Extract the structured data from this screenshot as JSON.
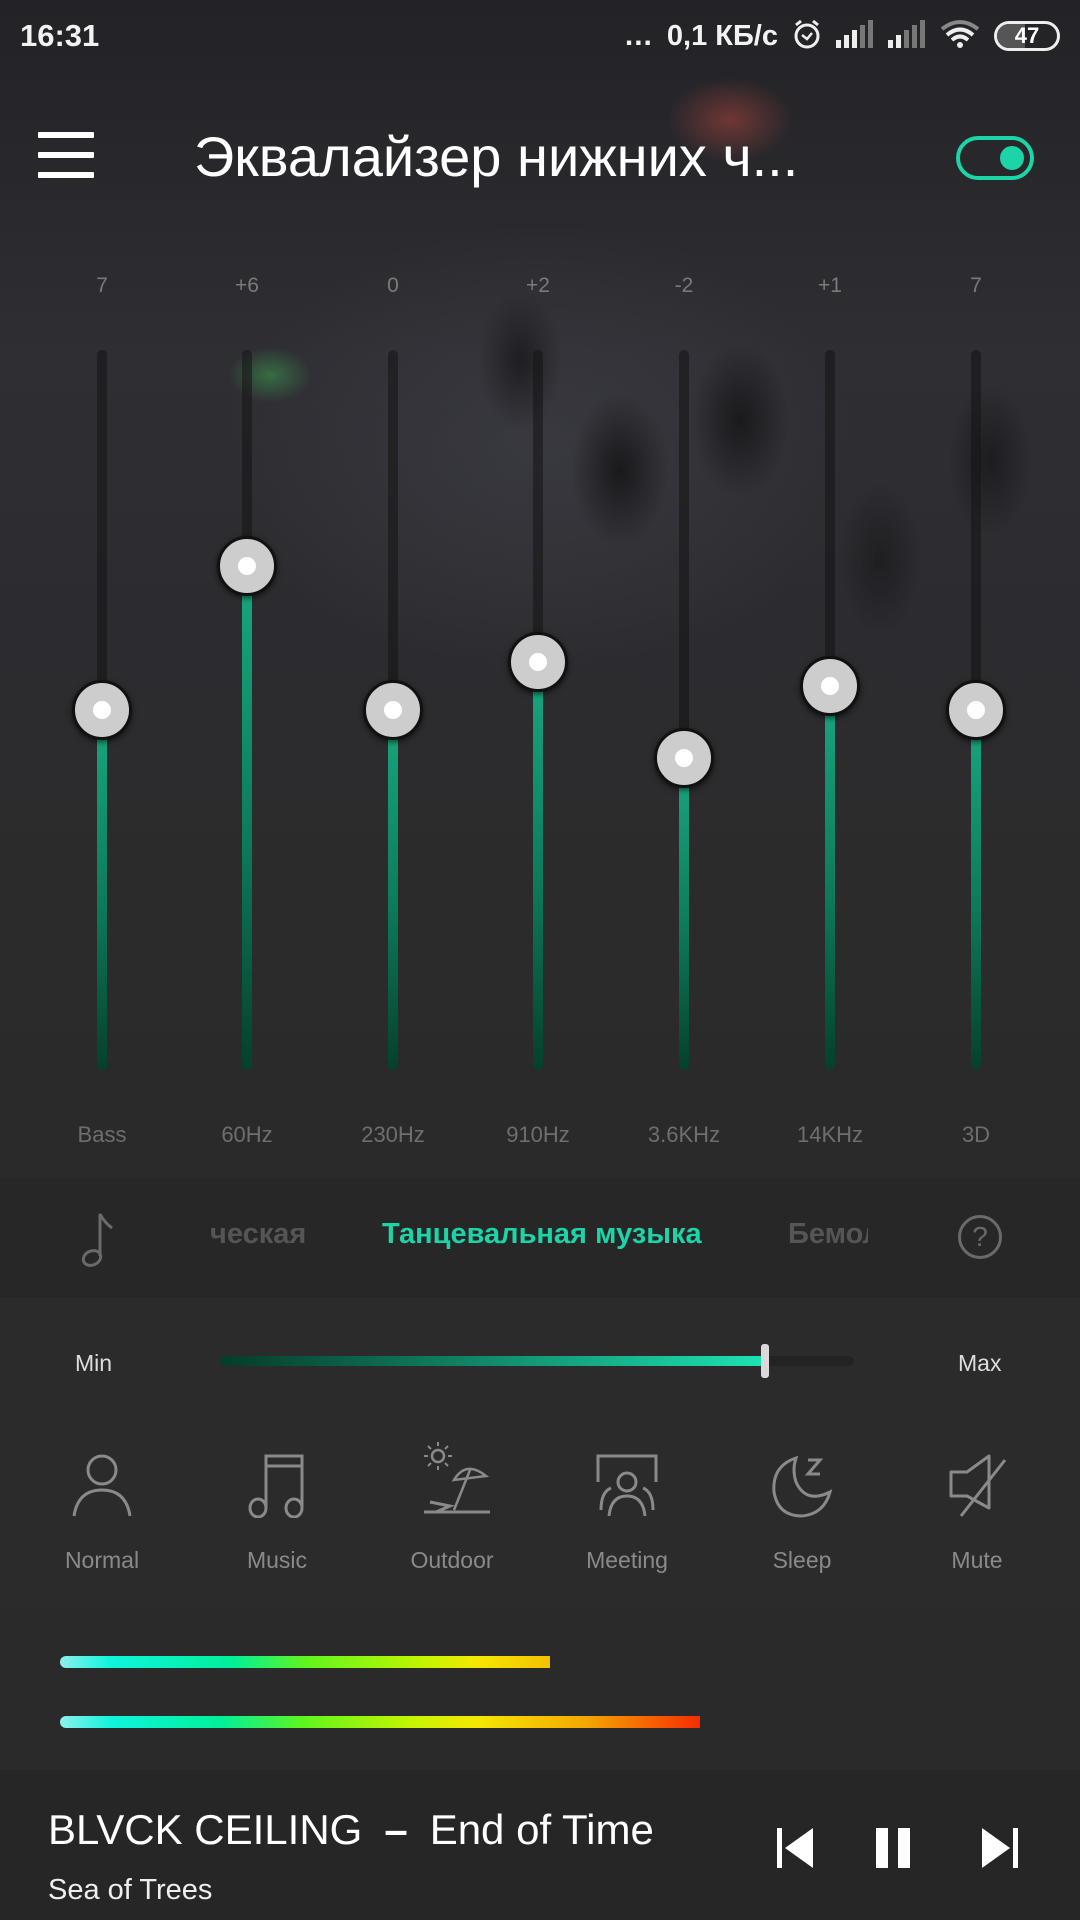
{
  "status_bar": {
    "time": "16:31",
    "dots": "...",
    "net_speed": "0,1 КБ/с",
    "icons": [
      "alarm-icon",
      "signal-icon",
      "signal-icon",
      "wifi-icon",
      "battery-icon"
    ],
    "battery": "47",
    "battery_percent": 47
  },
  "header": {
    "menu_icon": "hamburger-menu-icon",
    "title": "Эквалайзер нижних ч...",
    "toggle_on": true,
    "accent_color": "#1dd3a8"
  },
  "equalizer": {
    "range": [
      -15,
      15
    ],
    "bands": [
      {
        "label": "Bass",
        "value_text": "7",
        "position": 0.5
      },
      {
        "label": "60Hz",
        "value_text": "+6",
        "position": 0.7
      },
      {
        "label": "230Hz",
        "value_text": "0",
        "position": 0.5
      },
      {
        "label": "910Hz",
        "value_text": "+2",
        "position": 0.567
      },
      {
        "label": "3.6KHz",
        "value_text": "-2",
        "position": 0.433
      },
      {
        "label": "14KHz",
        "value_text": "+1",
        "position": 0.533
      },
      {
        "label": "3D",
        "value_text": "7",
        "position": 0.5
      }
    ]
  },
  "presets": {
    "icon": "music-note-icon",
    "previous": "ческая",
    "active": "Танцевальная музыка",
    "next": "Бемоль",
    "help_icon": "help-icon",
    "help_glyph": "?"
  },
  "intensity": {
    "min_label": "Min",
    "max_label": "Max",
    "value": 0.86
  },
  "modes": [
    {
      "label": "Normal",
      "icon": "person-icon"
    },
    {
      "label": "Music",
      "icon": "music-icon"
    },
    {
      "label": "Outdoor",
      "icon": "beach-umbrella-icon"
    },
    {
      "label": "Meeting",
      "icon": "meeting-icon"
    },
    {
      "label": "Sleep",
      "icon": "moon-sleep-icon"
    },
    {
      "label": "Mute",
      "icon": "mute-icon"
    }
  ],
  "meters": [
    {
      "name": "left-channel",
      "level": 0.49
    },
    {
      "name": "right-channel",
      "level": 0.64
    }
  ],
  "player": {
    "artist": "BLVCK CEILING",
    "separator": "–",
    "title": "End of Time",
    "album": "Sea of Trees",
    "controls": [
      "previous-icon",
      "pause-icon",
      "next-icon"
    ]
  }
}
